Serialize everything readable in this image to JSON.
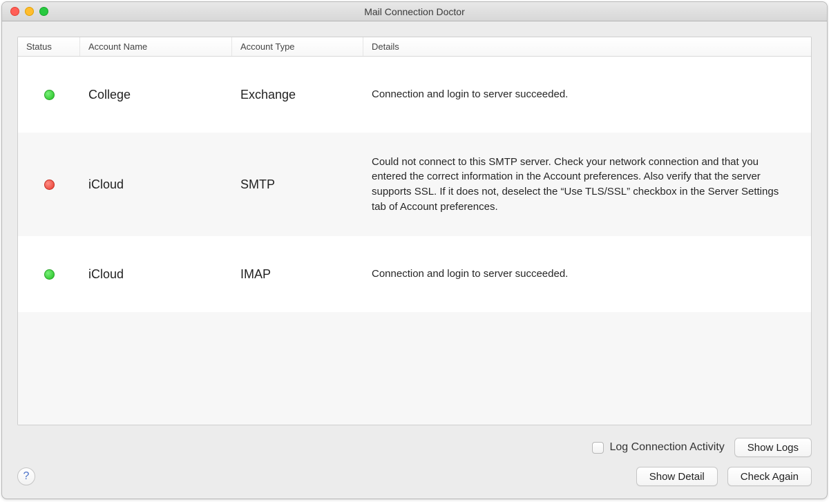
{
  "window": {
    "title": "Mail Connection Doctor"
  },
  "table": {
    "headers": {
      "status": "Status",
      "account_name": "Account Name",
      "account_type": "Account Type",
      "details": "Details"
    },
    "rows": [
      {
        "status_color": "green",
        "account_name": "College",
        "account_type": "Exchange",
        "details": "Connection and login to server succeeded."
      },
      {
        "status_color": "red",
        "account_name": "iCloud",
        "account_type": "SMTP",
        "details": "Could not connect to this SMTP server. Check your network connection and that you entered the correct information in the Account preferences. Also verify that the server supports SSL. If it does not, deselect the “Use TLS/SSL” checkbox in the Server Settings tab of Account preferences."
      },
      {
        "status_color": "green",
        "account_name": "iCloud",
        "account_type": "IMAP",
        "details": "Connection and login to server succeeded."
      }
    ]
  },
  "footer": {
    "log_checkbox_label": "Log Connection Activity",
    "log_checkbox_checked": false,
    "show_logs": "Show Logs",
    "show_detail": "Show Detail",
    "check_again": "Check Again",
    "help_symbol": "?"
  }
}
